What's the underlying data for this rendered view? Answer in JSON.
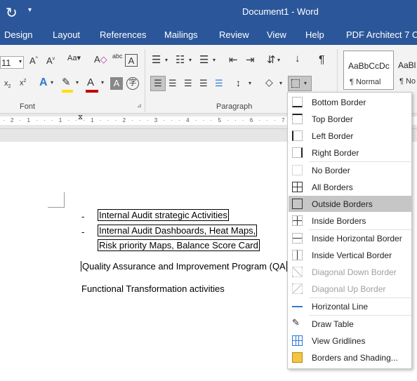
{
  "title_bar": {
    "title": "Document1  -  Word"
  },
  "tabs": [
    "Design",
    "Layout",
    "References",
    "Mailings",
    "Review",
    "View",
    "Help",
    "PDF Architect 7 C"
  ],
  "ribbon": {
    "font_size": "11",
    "font_group_label": "Font",
    "paragraph_group_label": "Paragraph",
    "styles": [
      {
        "preview": "AaBbCcDc",
        "name": "¶ Normal"
      },
      {
        "preview": "AaBl",
        "name": "¶ No"
      }
    ]
  },
  "ruler": {
    "text": "· 2 · 1 · · · 1 · · · 1 · · · 2 · · · 3 · · · 4 · · · 5 · · · 6 · · · 7 · · · 8 · · · 9 · · 10 · · 11"
  },
  "document": {
    "lines": [
      {
        "bullet": "-",
        "text": "Internal Audit strategic Activities"
      },
      {
        "bullet": "-",
        "text": "Internal Audit Dashboards, Heat Maps,"
      },
      {
        "bullet": "",
        "text": "Risk priority Maps, Balance Score Card"
      }
    ],
    "qa_line": "Quality Assurance and Improvement Program (QA",
    "func_line": "Functional Transformation activities"
  },
  "border_menu": {
    "items": [
      {
        "label": "Bottom Border",
        "icon": "bottom-border-icon",
        "state": "normal"
      },
      {
        "label": "Top Border",
        "icon": "top-border-icon",
        "state": "normal"
      },
      {
        "label": "Left Border",
        "icon": "left-border-icon",
        "state": "normal"
      },
      {
        "label": "Right Border",
        "icon": "right-border-icon",
        "state": "normal"
      },
      {
        "label": "No Border",
        "icon": "no-border-icon",
        "state": "normal"
      },
      {
        "label": "All Borders",
        "icon": "all-borders-icon",
        "state": "normal"
      },
      {
        "label": "Outside Borders",
        "icon": "outside-borders-icon",
        "state": "highlighted"
      },
      {
        "label": "Inside Borders",
        "icon": "inside-borders-icon",
        "state": "normal"
      },
      {
        "label": "Inside Horizontal Border",
        "icon": "inside-horizontal-border-icon",
        "state": "normal"
      },
      {
        "label": "Inside Vertical Border",
        "icon": "inside-vertical-border-icon",
        "state": "normal"
      },
      {
        "label": "Diagonal Down Border",
        "icon": "diagonal-down-border-icon",
        "state": "disabled"
      },
      {
        "label": "Diagonal Up Border",
        "icon": "diagonal-up-border-icon",
        "state": "disabled"
      },
      {
        "label": "Horizontal Line",
        "icon": "horizontal-line-icon",
        "state": "normal"
      },
      {
        "label": "Draw Table",
        "icon": "draw-table-icon",
        "state": "normal"
      },
      {
        "label": "View Gridlines",
        "icon": "view-gridlines-icon",
        "state": "normal"
      },
      {
        "label": "Borders and Shading...",
        "icon": "borders-and-shading-icon",
        "state": "normal"
      }
    ]
  },
  "colors": {
    "ribbon_blue": "#2b579a",
    "highlight": "#c6c6c6",
    "font_color_red": "#c00000",
    "highlighter_yellow": "#ffe000"
  }
}
